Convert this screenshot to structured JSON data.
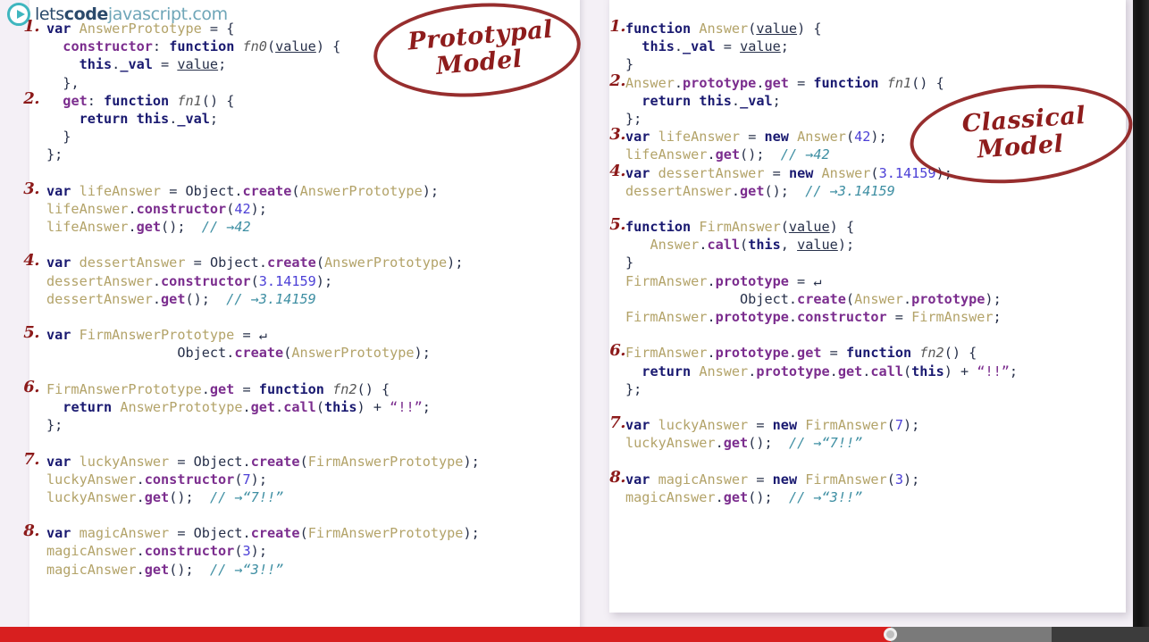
{
  "brand": {
    "logo_icon": "play-circle-icon",
    "name_part1": "lets",
    "name_part2": "code",
    "name_part3": "javascript",
    "name_part4": ".com"
  },
  "annotations": [
    {
      "id": "prototypal",
      "line1": "Prototypal",
      "line2": "Model",
      "color": "#8e1c1c"
    },
    {
      "id": "classical",
      "line1": "Classical",
      "line2": "Model",
      "color": "#8e1c1c"
    }
  ],
  "left_panel": {
    "title": "Prototypal Model",
    "steps": [
      {
        "number": "1.",
        "lines": [
          "var AnswerPrototype = {",
          "  constructor: function fn0(value) {",
          "    this._val = value;",
          "  },"
        ]
      },
      {
        "number": "2.",
        "lines": [
          "  get: function fn1() {",
          "    return this._val;",
          "  }",
          "};"
        ]
      },
      {
        "number": "3.",
        "lines": [
          "var lifeAnswer = Object.create(AnswerPrototype);",
          "lifeAnswer.constructor(42);",
          "lifeAnswer.get();  // →42"
        ]
      },
      {
        "number": "4.",
        "lines": [
          "var dessertAnswer = Object.create(AnswerPrototype);",
          "dessertAnswer.constructor(3.14159);",
          "dessertAnswer.get();  // →3.14159"
        ]
      },
      {
        "number": "5.",
        "lines": [
          "var FirmAnswerPrototype = ↵",
          "                Object.create(AnswerPrototype);"
        ]
      },
      {
        "number": "6.",
        "lines": [
          "FirmAnswerPrototype.get = function fn2() {",
          "  return AnswerPrototype.get.call(this) + “!!”;",
          "};"
        ]
      },
      {
        "number": "7.",
        "lines": [
          "var luckyAnswer = Object.create(FirmAnswerPrototype);",
          "luckyAnswer.constructor(7);",
          "luckyAnswer.get();  // →“7!!”"
        ]
      },
      {
        "number": "8.",
        "lines": [
          "var magicAnswer = Object.create(FirmAnswerPrototype);",
          "magicAnswer.constructor(3);",
          "magicAnswer.get();  // →“3!!”"
        ]
      }
    ]
  },
  "right_panel": {
    "title": "Classical Model",
    "steps": [
      {
        "number": "1.",
        "lines": [
          "function Answer(value) {",
          "  this._val = value;",
          "}"
        ]
      },
      {
        "number": "2.",
        "lines": [
          "Answer.prototype.get = function fn1() {",
          "  return this._val;",
          "};"
        ]
      },
      {
        "number": "3.",
        "lines": [
          "var lifeAnswer = new Answer(42);",
          "lifeAnswer.get();  // →42"
        ]
      },
      {
        "number": "4.",
        "lines": [
          "var dessertAnswer = new Answer(3.14159);",
          "dessertAnswer.get();  // →3.14159"
        ]
      },
      {
        "number": "5.",
        "lines": [
          "function FirmAnswer(value) {",
          "   Answer.call(this, value);",
          "}",
          "FirmAnswer.prototype = ↵",
          "              Object.create(Answer.prototype);",
          "FirmAnswer.prototype.constructor = FirmAnswer;"
        ]
      },
      {
        "number": "6.",
        "lines": [
          "FirmAnswer.prototype.get = function fn2() {",
          "  return Answer.prototype.get.call(this) + “!!”;",
          "};"
        ]
      },
      {
        "number": "7.",
        "lines": [
          "var luckyAnswer = new FirmAnswer(7);",
          "luckyAnswer.get();  // →“7!!”"
        ]
      },
      {
        "number": "8.",
        "lines": [
          "var magicAnswer = new FirmAnswer(3);",
          "magicAnswer.get();  // →“3!!”"
        ]
      }
    ]
  },
  "player": {
    "played_percent": 77.5,
    "buffered_percent": 91.5,
    "handle_percent": 77.5,
    "played_color": "#d81f1f",
    "buffered_color": "#7a7a7a",
    "track_color": "#3c3c3c"
  },
  "colors": {
    "keyword": "#191970",
    "identifier": "#b3a369",
    "member": "#7b2d8e",
    "number": "#4b3fd6",
    "comment": "#3f8fa3",
    "annotation": "#8e1c1c",
    "page_background": "#f4f0f6",
    "card_background": "#ffffff"
  }
}
